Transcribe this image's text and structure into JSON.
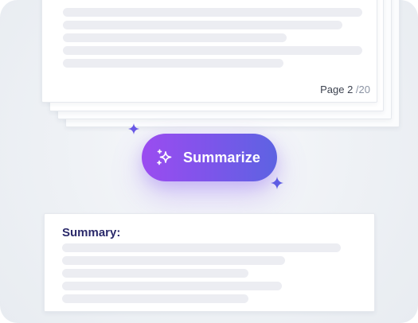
{
  "document": {
    "page_label": "Page 2",
    "page_total": "/20"
  },
  "action": {
    "summarize_label": "Summarize",
    "icon": "sparkles-icon"
  },
  "summary": {
    "title": "Summary:"
  },
  "colors": {
    "button_gradient_start": "#9b4cf0",
    "button_gradient_end": "#5d63e2",
    "sparkle": "#6a59e6",
    "summary_title": "#2b2a6b",
    "placeholder_line": "#ecedf2"
  }
}
